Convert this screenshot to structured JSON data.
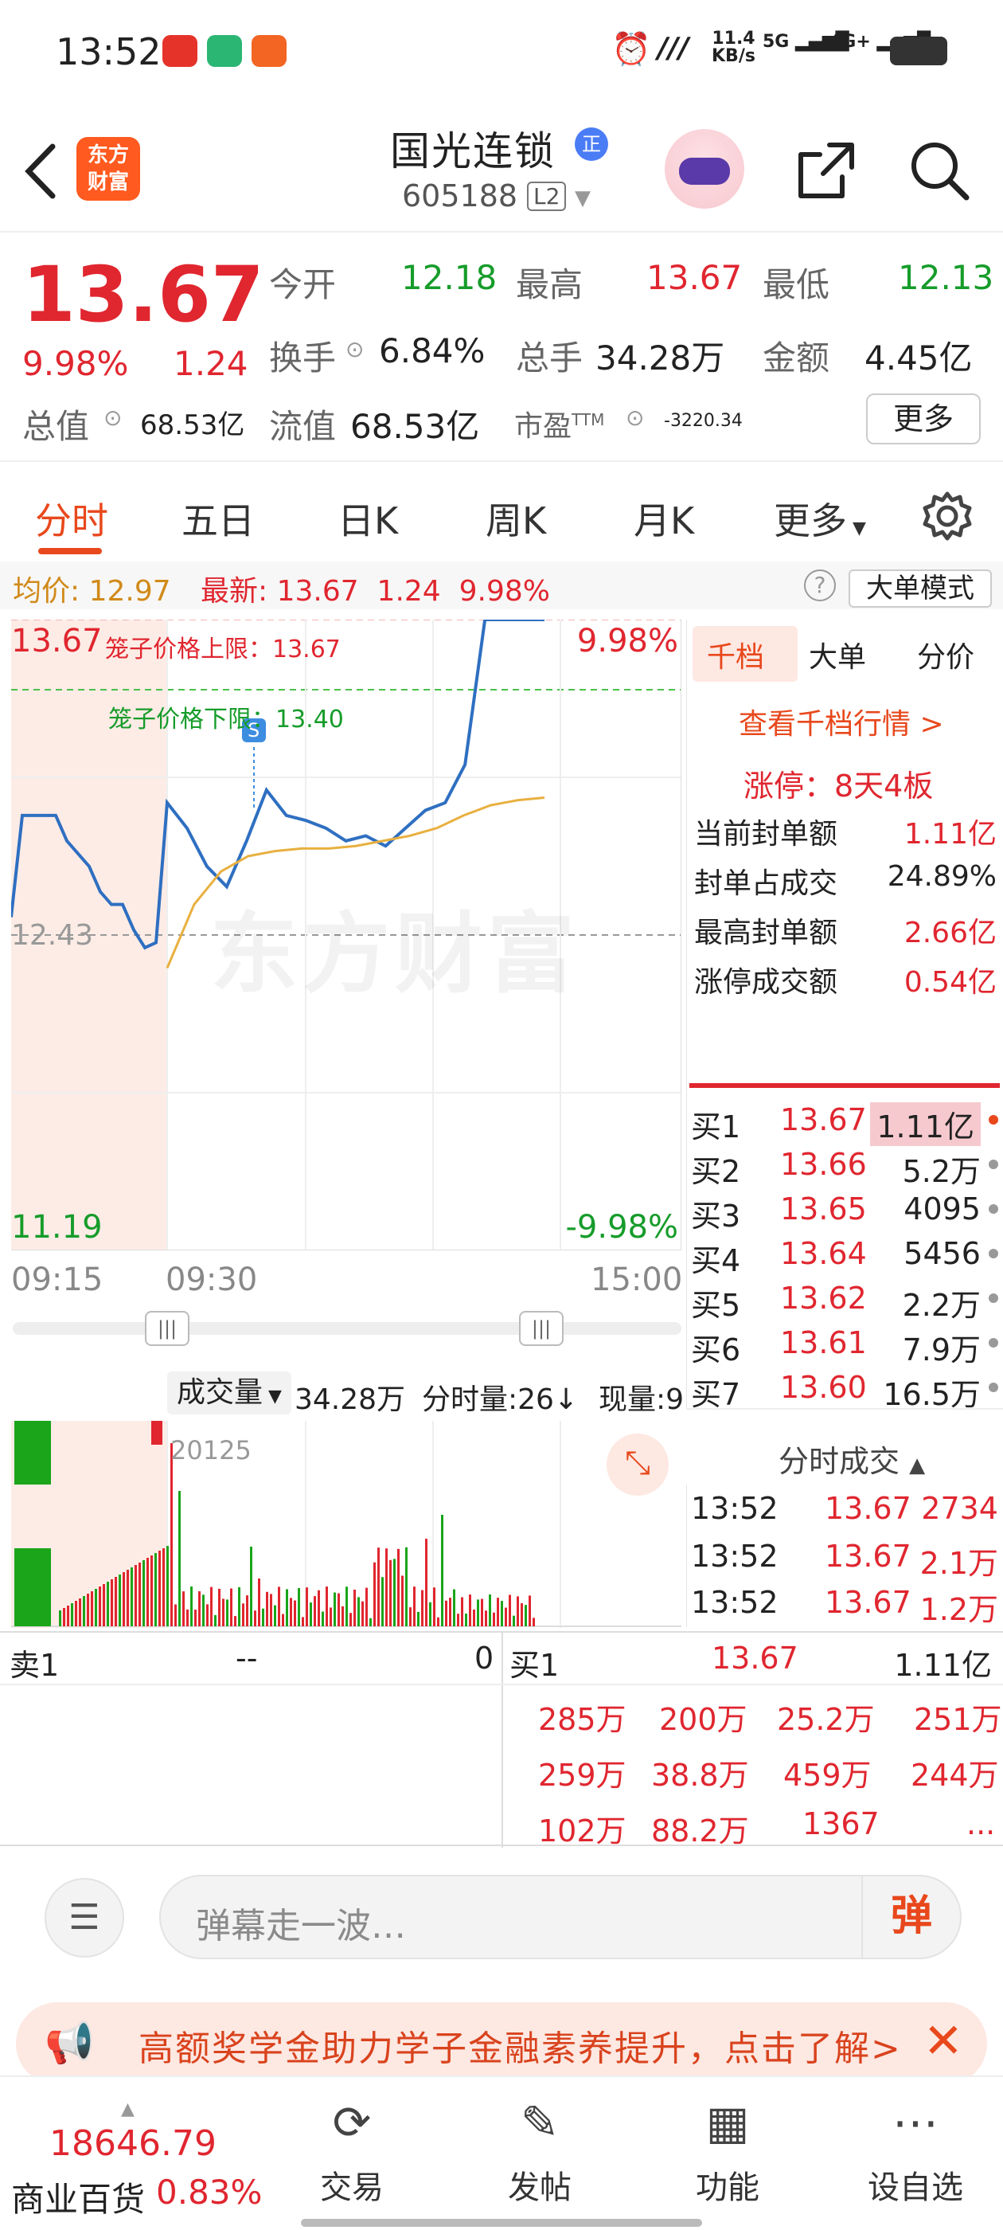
{
  "status_bar": {
    "time": "13:52",
    "net_speed_value": "11.4",
    "net_speed_unit": "KB/s",
    "sim1": "5G",
    "sim2": "4G+"
  },
  "header": {
    "logo_line1": "东方",
    "logo_line2": "财富",
    "stock_name": "国光连锁",
    "badge": "正",
    "code": "605188",
    "level": "L2"
  },
  "quote": {
    "price": "13.67",
    "change_pct": "9.98%",
    "change": "1.24",
    "open_label": "今开",
    "open": "12.18",
    "high_label": "最高",
    "high": "13.67",
    "low_label": "最低",
    "low": "12.13",
    "turnover_label": "换手",
    "turnover": "6.84%",
    "volume_label": "总手",
    "volume": "34.28万",
    "amount_label": "金额",
    "amount": "4.45亿",
    "mktcap_label": "总值",
    "mktcap": "68.53亿",
    "float_label": "流值",
    "float": "68.53亿",
    "pe_label": "市盈",
    "pe_sup": "TTM",
    "pe": "-3220.34",
    "more_label": "更多"
  },
  "tabs": [
    "分时",
    "五日",
    "日K",
    "周K",
    "月K",
    "更多"
  ],
  "avg_bar": {
    "avg_label": "均价:",
    "avg": "12.97",
    "last_label": "最新:",
    "last": "13.67",
    "change": "1.24",
    "change_pct": "9.98%",
    "mode_label": "大单模式"
  },
  "chart": {
    "top_price": "13.67",
    "top_pct": "9.98%",
    "mid_price": "12.43",
    "bottom_price": "11.19",
    "bottom_pct": "-9.98%",
    "cage_upper": "笼子价格上限：13.67",
    "cage_lower": "笼子价格下限：13.40",
    "watermark": "东方财富",
    "time_start": "09:15",
    "time_open": "09:30",
    "time_end": "15:00"
  },
  "chart_data": {
    "type": "line",
    "ylim": [
      11.19,
      13.67
    ],
    "reference": 12.43,
    "series": [
      {
        "values": [
          12.5,
          12.9,
          12.9,
          12.9,
          12.9,
          12.8,
          12.75,
          12.7,
          12.6,
          12.55,
          12.55,
          12.45,
          12.38,
          12.4,
          12.95,
          12.85,
          12.7,
          12.62,
          12.8,
          13.0,
          12.9,
          12.88,
          12.85,
          12.8,
          12.82,
          12.78,
          12.85,
          12.92,
          12.95,
          13.1,
          13.67,
          13.67,
          13.67,
          13.67
        ]
      },
      {
        "values": [
          12.3,
          12.55,
          12.68,
          12.74,
          12.76,
          12.77,
          12.77,
          12.78,
          12.8,
          12.82,
          12.85,
          12.9,
          12.94,
          12.96,
          12.97
        ]
      }
    ]
  },
  "panel": {
    "tabs": [
      "千档",
      "大单",
      "分价"
    ],
    "view_link": "查看千档行情 >",
    "limit_up": "涨停：8天4板",
    "stats": [
      {
        "label": "当前封单额",
        "value": "1.11亿"
      },
      {
        "label": "封单占成交",
        "value": "24.89%"
      },
      {
        "label": "最高封单额",
        "value": "2.66亿"
      },
      {
        "label": "涨停成交额",
        "value": "0.54亿"
      }
    ],
    "book": [
      {
        "label": "买1",
        "price": "13.67",
        "vol": "1.11亿"
      },
      {
        "label": "买2",
        "price": "13.66",
        "vol": "5.2万"
      },
      {
        "label": "买3",
        "price": "13.65",
        "vol": "4095"
      },
      {
        "label": "买4",
        "price": "13.64",
        "vol": "5456"
      },
      {
        "label": "买5",
        "price": "13.62",
        "vol": "2.2万"
      },
      {
        "label": "买6",
        "price": "13.61",
        "vol": "7.9万"
      },
      {
        "label": "买7",
        "price": "13.60",
        "vol": "16.5万"
      }
    ],
    "ticks_title": "分时成交",
    "ticks": [
      {
        "time": "13:52",
        "price": "13.67",
        "vol": "2734"
      },
      {
        "time": "13:52",
        "price": "13.67",
        "vol": "2.1万"
      },
      {
        "time": "13:52",
        "price": "13.67",
        "vol": "1.2万"
      }
    ]
  },
  "volume": {
    "selector": "成交量",
    "total": "34.28万",
    "minute": "分时量:26↓",
    "current": "现量:9",
    "peak": "20125"
  },
  "depth": {
    "sell1_label": "卖1",
    "sell1_price": "--",
    "sell1_vol": "0",
    "buy1_label": "买1",
    "buy1_price": "13.67",
    "buy1_vol": "1.11亿",
    "queue": [
      [
        "285万",
        "200万",
        "25.2万",
        "251万"
      ],
      [
        "259万",
        "38.8万",
        "459万",
        "244万"
      ],
      [
        "102万",
        "88.2万",
        "1367",
        "..."
      ]
    ]
  },
  "danmu": {
    "placeholder": "弹幕走一波…",
    "send": "弹"
  },
  "banner": {
    "text": "高额奖学金助力学子金融素养提升，点击了解>"
  },
  "bottom": {
    "index_value": "18646.79",
    "index_name": "商业百货",
    "index_pct": "0.83%",
    "items": [
      "交易",
      "发帖",
      "功能",
      "设自选"
    ]
  }
}
